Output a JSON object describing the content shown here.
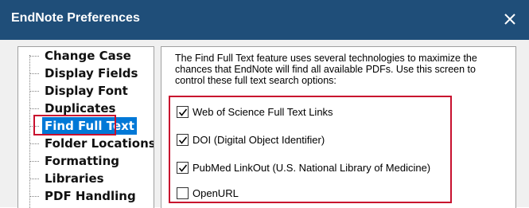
{
  "window": {
    "title": "EndNote Preferences",
    "close_icon": "close-icon"
  },
  "sidebar": {
    "items": [
      {
        "label": "Change Case",
        "selected": false
      },
      {
        "label": "Display Fields",
        "selected": false
      },
      {
        "label": "Display Font",
        "selected": false
      },
      {
        "label": "Duplicates",
        "selected": false
      },
      {
        "label": "Find Full Text",
        "selected": true
      },
      {
        "label": "Folder Locations",
        "selected": false
      },
      {
        "label": "Formatting",
        "selected": false
      },
      {
        "label": "Libraries",
        "selected": false
      },
      {
        "label": "PDF Handling",
        "selected": false
      }
    ]
  },
  "main": {
    "description": "The Find Full Text feature uses several technologies to maximize the chances that EndNote will find all available PDFs. Use this screen to control these full text search options:",
    "options": [
      {
        "label": "Web of Science Full Text Links",
        "checked": true
      },
      {
        "label": "DOI (Digital Object Identifier)",
        "checked": true
      },
      {
        "label": "PubMed LinkOut (U.S. National Library of Medicine)",
        "checked": true
      },
      {
        "label": "OpenURL",
        "checked": false
      }
    ]
  },
  "colors": {
    "titlebar": "#1f4e79",
    "highlight_box": "#c8102e",
    "selection": "#0078d7"
  }
}
